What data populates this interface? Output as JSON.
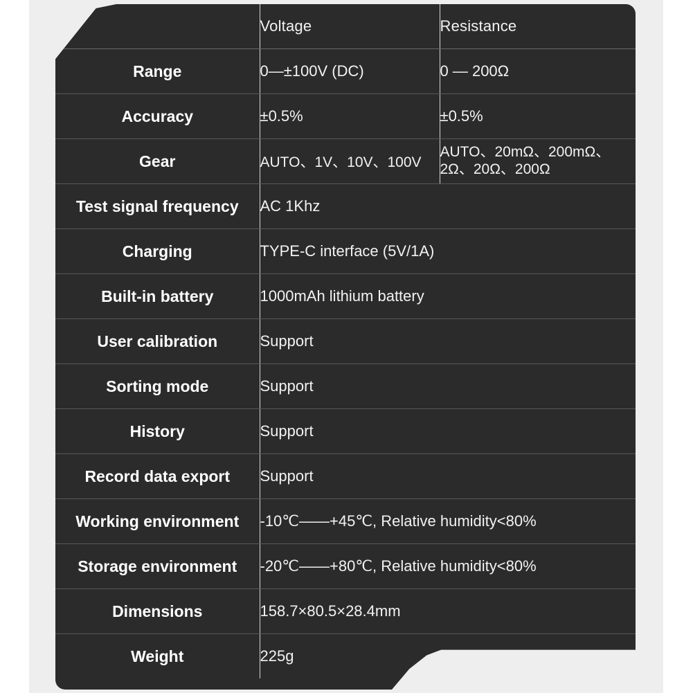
{
  "table": {
    "columns": [
      "",
      "Voltage",
      "Resistance"
    ],
    "rows": [
      {
        "label": "Range",
        "voltage": "0—±100V (DC)",
        "resistance": "0 — 200Ω",
        "split": true
      },
      {
        "label": "Accuracy",
        "voltage": "±0.5%",
        "resistance": "±0.5%",
        "split": true
      },
      {
        "label": "Gear",
        "voltage": "AUTO、1V、10V、100V",
        "resistance": "AUTO、20mΩ、200mΩ、",
        "resistance2": "2Ω、20Ω、200Ω",
        "split": true
      },
      {
        "label": "Test signal frequency",
        "value": "AC 1Khz",
        "split": false
      },
      {
        "label": "Charging",
        "value": "TYPE-C interface (5V/1A)",
        "split": false
      },
      {
        "label": "Built-in battery",
        "value": "1000mAh lithium battery",
        "split": false
      },
      {
        "label": "User calibration",
        "value": "Support",
        "split": false
      },
      {
        "label": "Sorting mode",
        "value": "Support",
        "split": false
      },
      {
        "label": "History",
        "value": "Support",
        "split": false
      },
      {
        "label": "Record data export",
        "value": "Support",
        "split": false
      },
      {
        "label": "Working environment",
        "value": "-10℃——+45℃, Relative humidity<80%",
        "split": false
      },
      {
        "label": "Storage environment",
        "value": "-20℃——+80℃, Relative humidity<80%",
        "split": false
      },
      {
        "label": "Dimensions",
        "value": "158.7×80.5×28.4mm",
        "split": false
      },
      {
        "label": "Weight",
        "value": "225g",
        "split": false
      }
    ]
  },
  "colors": {
    "card_background": "#2b2b2b",
    "page_background": "#ffffff",
    "backing_band": "#eeeeee",
    "text": "#ffffff",
    "value_text": "#f2f2f2",
    "divider": "#d6d6d6",
    "row_divider": "#595959"
  }
}
